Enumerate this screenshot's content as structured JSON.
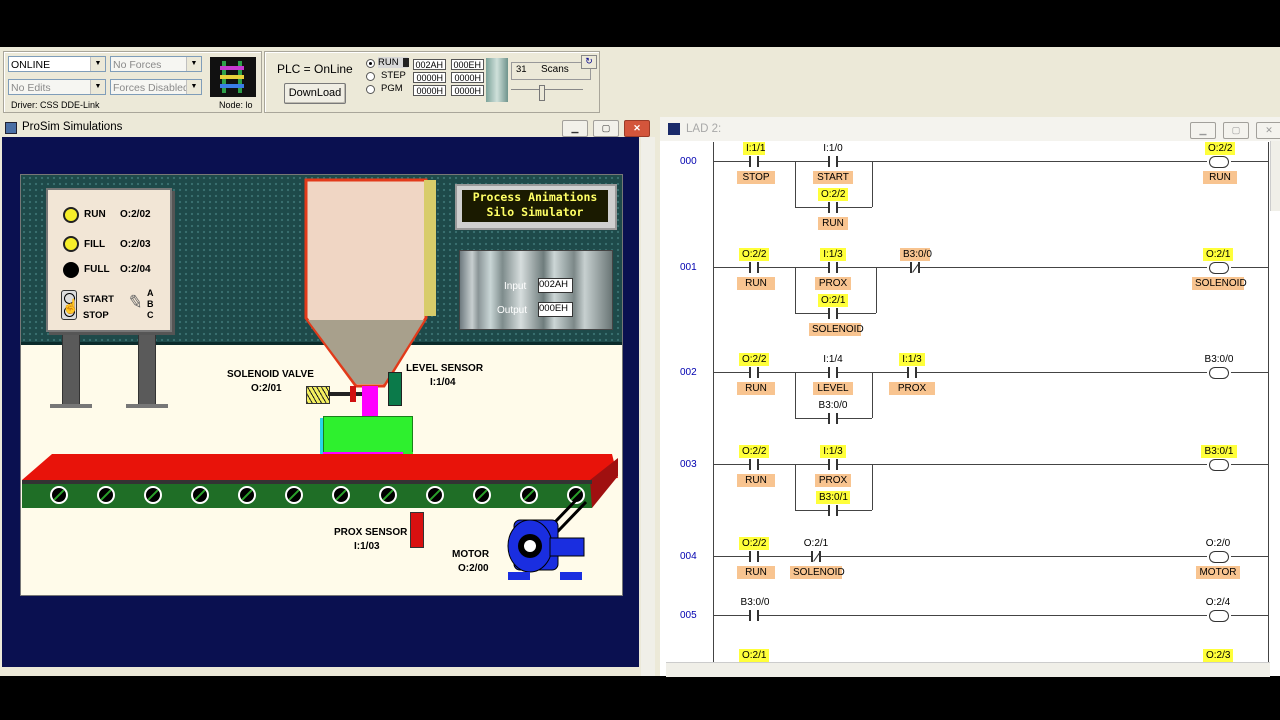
{
  "toolbar": {
    "mode_combo": "ONLINE",
    "forces_combo": "No Forces",
    "edits_combo": "No Edits",
    "forces_enable_combo": "Forces Disabled",
    "driver": "Driver: CSS DDE-Link",
    "node": "Node: lo",
    "plc_status": "PLC = OnLine",
    "download_label": "DownLoad",
    "run_label": "RUN",
    "step_label": "STEP",
    "pgm_label": "PGM",
    "reg_values": [
      "002AH",
      "000EH",
      "0000H",
      "0000H",
      "0000H",
      "0000H"
    ],
    "scans_value": "31",
    "scans_label": "Scans"
  },
  "sim_window": {
    "title": "ProSim Simulations",
    "banner_line1": "Process Animations",
    "banner_line2": "Silo Simulator",
    "input_label": "Input",
    "input_value": "002AH",
    "output_label": "Output",
    "output_value": "000EH",
    "panel": {
      "run": "RUN",
      "run_addr": "O:2/02",
      "fill": "FILL",
      "fill_addr": "O:2/03",
      "full": "FULL",
      "full_addr": "O:2/04",
      "start": "START",
      "stop": "STOP",
      "abc_a": "A",
      "abc_b": "B",
      "abc_c": "C"
    },
    "solenoid_label": "SOLENOID VALVE",
    "solenoid_addr": "O:2/01",
    "level_label": "LEVEL SENSOR",
    "level_addr": "I:1/04",
    "prox_label": "PROX SENSOR",
    "prox_addr": "I:1/03",
    "motor_label": "MOTOR",
    "motor_addr": "O:2/00"
  },
  "ladder_window": {
    "title": "LAD 2:",
    "rungs": [
      {
        "num": "000",
        "c1_addr": "I:1/1",
        "c1_name": "STOP",
        "c2_addr": "I:1/0",
        "c2_name": "START",
        "b_addr": "O:2/2",
        "b_name": "RUN",
        "coil_addr": "O:2/2",
        "coil_name": "RUN"
      },
      {
        "num": "001",
        "c1_addr": "O:2/2",
        "c1_name": "RUN",
        "c2_addr": "I:1/3",
        "c2_name": "PROX",
        "b_addr": "O:2/1",
        "b_name": "SOLENOID",
        "c3_addr": "B3:0/0",
        "coil_addr": "O:2/1",
        "coil_name": "SOLENOID"
      },
      {
        "num": "002",
        "c1_addr": "O:2/2",
        "c1_name": "RUN",
        "c2_addr": "I:1/4",
        "c2_name": "LEVEL",
        "b_addr": "B3:0/0",
        "c3_addr": "I:1/3",
        "c3_name": "PROX",
        "coil_addr": "B3:0/0"
      },
      {
        "num": "003",
        "c1_addr": "O:2/2",
        "c1_name": "RUN",
        "c2_addr": "I:1/3",
        "c2_name": "PROX",
        "b_addr": "B3:0/1",
        "coil_addr": "B3:0/1"
      },
      {
        "num": "004",
        "c1_addr": "O:2/2",
        "c1_name": "RUN",
        "c2_addr": "O:2/1",
        "c2_name": "SOLENOID",
        "coil_addr": "O:2/0",
        "coil_name": "MOTOR"
      },
      {
        "num": "005",
        "c1_addr": "B3:0/0",
        "coil_addr": "O:2/4"
      },
      {
        "c1_addr": "O:2/1",
        "coil_addr": "O:2/3"
      }
    ]
  },
  "colors": {
    "sim_background": "#0a1050",
    "wall": "#1e4a4a",
    "floor": "#fffbea",
    "belt": "#e8130a",
    "hopper": "#f0d6c4",
    "box_top": "#2ef02e",
    "box_bottom": "#ff00ff",
    "address_highlight": "#ffff3a",
    "name_highlight": "#f8c490",
    "rung_number": "#0000b0"
  }
}
